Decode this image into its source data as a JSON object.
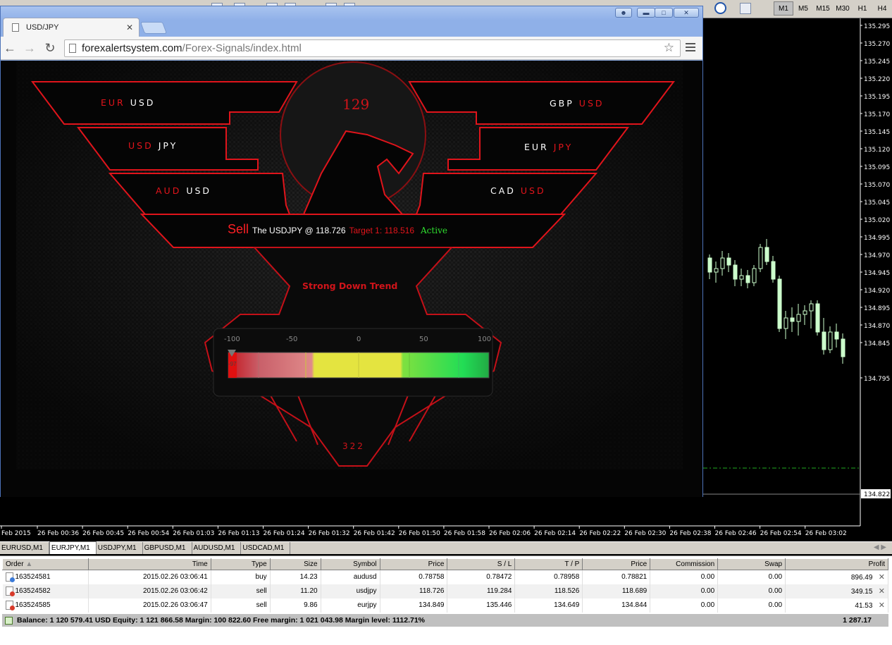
{
  "platform": {
    "timeframes": [
      "M1",
      "M5",
      "M15",
      "M30",
      "H1",
      "H4"
    ],
    "active_timeframe": "M1"
  },
  "browser": {
    "tab_title": "USD/JPY",
    "url_domain": "forexalertsystem.com",
    "url_path": "/Forex-Signals/index.html"
  },
  "signal_page": {
    "counter_top": "129",
    "counter_bottom": "322",
    "pairs_left": [
      {
        "base": "EUR",
        "quote": "USD"
      },
      {
        "base": "USD",
        "quote": "JPY"
      },
      {
        "base": "AUD",
        "quote": "USD"
      }
    ],
    "pairs_right": [
      {
        "base": "GBP",
        "quote": "USD"
      },
      {
        "base": "EUR",
        "quote": "JPY"
      },
      {
        "base": "CAD",
        "quote": "USD"
      }
    ],
    "signal": {
      "action": "Sell",
      "text": "The USDJPY @ 118.726",
      "target": "Target 1: 118.516",
      "status": "Active"
    },
    "trend": "Strong Down Trend",
    "gauge": {
      "ticks": [
        "-100",
        "-50",
        "0",
        "50",
        "100"
      ],
      "value": -97,
      "value_label": "-97"
    }
  },
  "chart": {
    "price_ticks": [
      "135.295",
      "135.270",
      "135.245",
      "135.220",
      "135.195",
      "135.170",
      "135.145",
      "135.120",
      "135.095",
      "135.070",
      "135.045",
      "135.020",
      "134.995",
      "134.970",
      "134.945",
      "134.920",
      "134.895",
      "134.870",
      "134.845",
      "134.822",
      "134.795"
    ],
    "current_price": "134.822",
    "time_ticks": [
      "Feb 2015",
      "26 Feb 00:36",
      "26 Feb 00:45",
      "26 Feb 00:54",
      "26 Feb 01:03",
      "26 Feb 01:13",
      "26 Feb 01:24",
      "26 Feb 01:32",
      "26 Feb 01:42",
      "26 Feb 01:50",
      "26 Feb 01:58",
      "26 Feb 02:06",
      "26 Feb 02:14",
      "26 Feb 02:22",
      "26 Feb 02:30",
      "26 Feb 02:38",
      "26 Feb 02:46",
      "26 Feb 02:54",
      "26 Feb 03:02"
    ],
    "candle_color": "#ccffcc",
    "level_line_color": "#22aa22"
  },
  "chart_tabs": [
    "EURUSD,M1",
    "EURJPY,M1",
    "USDJPY,M1",
    "GBPUSD,M1",
    "AUDUSD,M1",
    "USDCAD,M1"
  ],
  "active_chart_tab": "EURJPY,M1",
  "terminal": {
    "columns": [
      "Order",
      "Time",
      "Type",
      "Size",
      "Symbol",
      "Price",
      "S / L",
      "T / P",
      "Price",
      "Commission",
      "Swap",
      "Profit"
    ],
    "rows": [
      {
        "order": "163524581",
        "time": "2015.02.26 03:06:41",
        "type": "buy",
        "size": "14.23",
        "symbol": "audusd",
        "price": "0.78758",
        "sl": "0.78472",
        "tp": "0.78958",
        "cur_price": "0.78821",
        "commission": "0.00",
        "swap": "0.00",
        "profit": "896.49"
      },
      {
        "order": "163524582",
        "time": "2015.02.26 03:06:42",
        "type": "sell",
        "size": "11.20",
        "symbol": "usdjpy",
        "price": "118.726",
        "sl": "119.284",
        "tp": "118.526",
        "cur_price": "118.689",
        "commission": "0.00",
        "swap": "0.00",
        "profit": "349.15"
      },
      {
        "order": "163524585",
        "time": "2015.02.26 03:06:47",
        "type": "sell",
        "size": "9.86",
        "symbol": "eurjpy",
        "price": "134.849",
        "sl": "135.446",
        "tp": "134.649",
        "cur_price": "134.844",
        "commission": "0.00",
        "swap": "0.00",
        "profit": "41.53"
      }
    ],
    "balance_line": "Balance: 1 120 579.41 USD  Equity: 1 121 866.58  Margin: 100 822.60  Free margin: 1 021 043.98  Margin level: 1112.71%",
    "total_profit": "1 287.17"
  }
}
